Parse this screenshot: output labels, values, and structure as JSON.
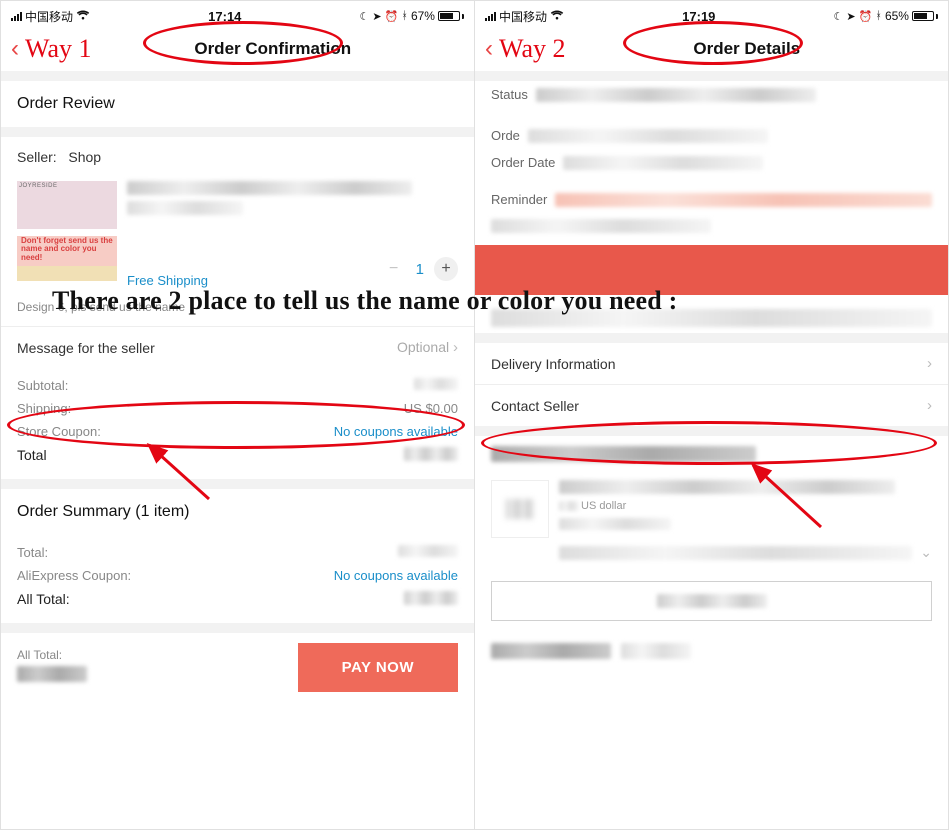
{
  "overlay_caption": "There are 2 place to tell us the name or color you need :",
  "left": {
    "status": {
      "carrier": "中国移动",
      "time": "17:14",
      "battery": "67%"
    },
    "way_tag": "Way 1",
    "title": "Order Confirmation",
    "review_title": "Order Review",
    "seller_label": "Seller:",
    "seller_name": "Shop",
    "product_thumb": {
      "brand": "JOYRESIDE",
      "reminder": "Don't forget send us the name and color you need!"
    },
    "free_shipping": "Free Shipping",
    "qty": "1",
    "variant_note": "Design 6, pls send us the name",
    "msg_seller": {
      "label": "Message for the seller",
      "hint": "Optional"
    },
    "sum1": {
      "subtotal_l": "Subtotal:",
      "shipping_l": "Shipping:",
      "shipping_v": "US $0.00",
      "coupon_l": "Store Coupon:",
      "coupon_v": "No coupons available",
      "total_l": "Total"
    },
    "summary_title": "Order Summary (1 item)",
    "sum2": {
      "total_l": "Total:",
      "ae_coupon_l": "AliExpress Coupon:",
      "ae_coupon_v": "No coupons available",
      "all_total_l": "All Total:"
    },
    "paybar": {
      "all_total_l": "All Total:",
      "btn": "PAY NOW"
    }
  },
  "right": {
    "status": {
      "carrier": "中国移动",
      "time": "17:19",
      "battery": "65%"
    },
    "way_tag": "Way 2",
    "title": "Order Details",
    "status_l": "Status",
    "order_l": "Orde",
    "orderdate_l": "Order Date",
    "reminder_l": "Reminder",
    "delivery_l": "Delivery Information",
    "contact_l": "Contact Seller",
    "currency_hint": "US dollar"
  }
}
